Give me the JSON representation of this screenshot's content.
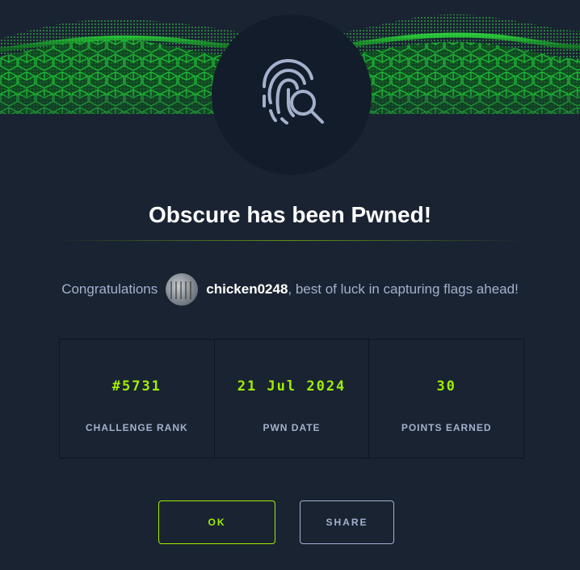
{
  "modal": {
    "title": "Obscure has been Pwned!",
    "emblem_icon": "fingerprint-search-icon",
    "banner": "green-matrix-wave-banner"
  },
  "congrats": {
    "prefix": "Congratulations",
    "username": "chicken0248",
    "suffix": ", best of luck in capturing flags ahead!"
  },
  "stats": [
    {
      "value": "#5731",
      "label": "CHALLENGE RANK"
    },
    {
      "value": "21 Jul 2024",
      "label": "PWN DATE"
    },
    {
      "value": "30",
      "label": "POINTS EARNED"
    }
  ],
  "buttons": {
    "ok_label": "OK",
    "share_label": "SHARE"
  },
  "colors": {
    "background": "#1a2332",
    "accent": "#9fef00",
    "muted_text": "#a4b1cd"
  }
}
